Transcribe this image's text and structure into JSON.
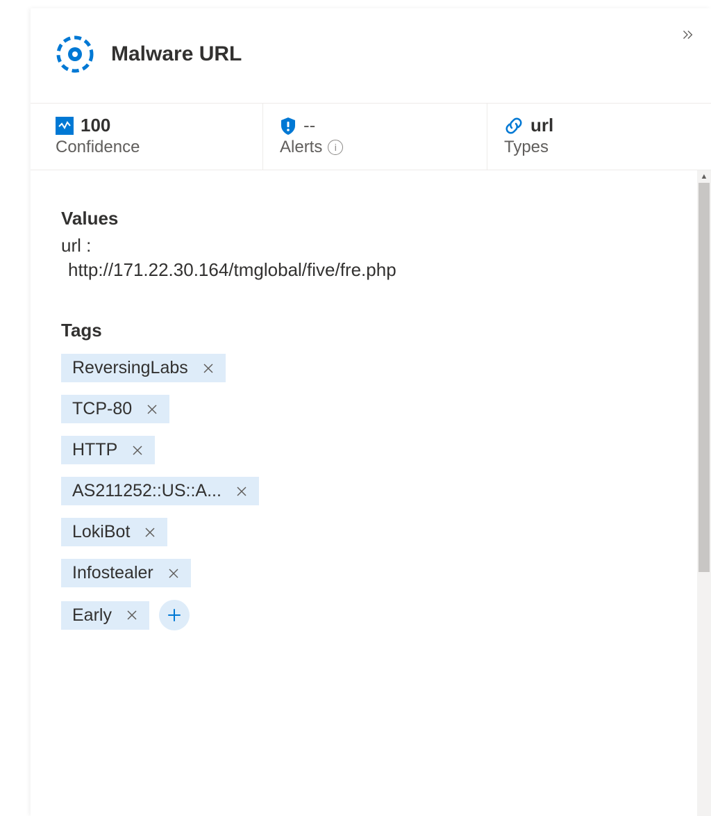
{
  "header": {
    "title": "Malware URL"
  },
  "stats": {
    "confidence": {
      "value": "100",
      "label": "Confidence"
    },
    "alerts": {
      "value": "--",
      "label": "Alerts"
    },
    "types": {
      "value": "url",
      "label": "Types"
    }
  },
  "values": {
    "heading": "Values",
    "key": "url  :",
    "url": "http://171.22.30.164/tmglobal/five/fre.php"
  },
  "tags": {
    "heading": "Tags",
    "items": [
      "ReversingLabs",
      "TCP-80",
      "HTTP",
      "AS211252::US::A...",
      "LokiBot",
      "Infostealer",
      "Early"
    ]
  }
}
